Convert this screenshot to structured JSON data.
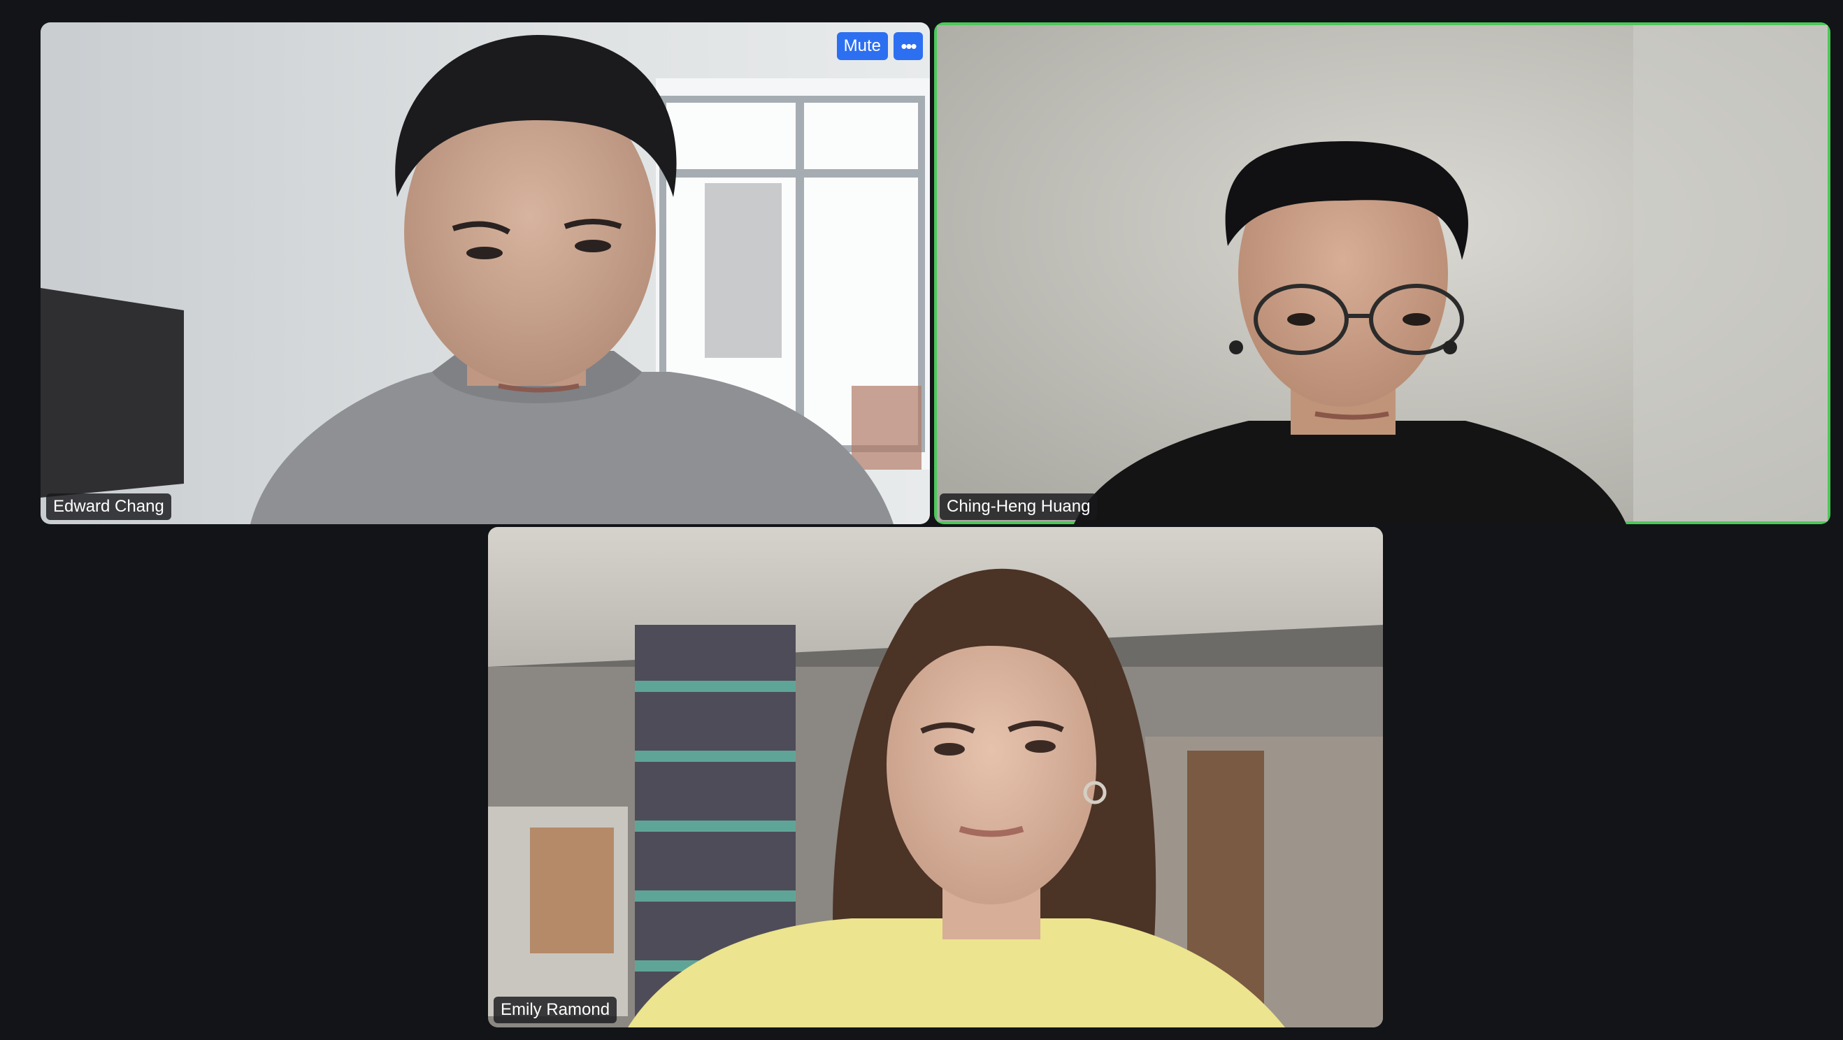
{
  "participants": [
    {
      "name": "Edward Chang",
      "active_speaker": false,
      "tile_controls": {
        "mute_label": "Mute",
        "more_icon": "more-options-icon",
        "more_glyph": "•••"
      }
    },
    {
      "name": "Ching-Heng Huang",
      "active_speaker": true
    },
    {
      "name": "Emily Ramond",
      "active_speaker": false
    }
  ],
  "colors": {
    "background": "#121417",
    "active_speaker_border": "#4cc85a",
    "button_accent": "#2d6ff1",
    "label_background": "#19191c"
  }
}
